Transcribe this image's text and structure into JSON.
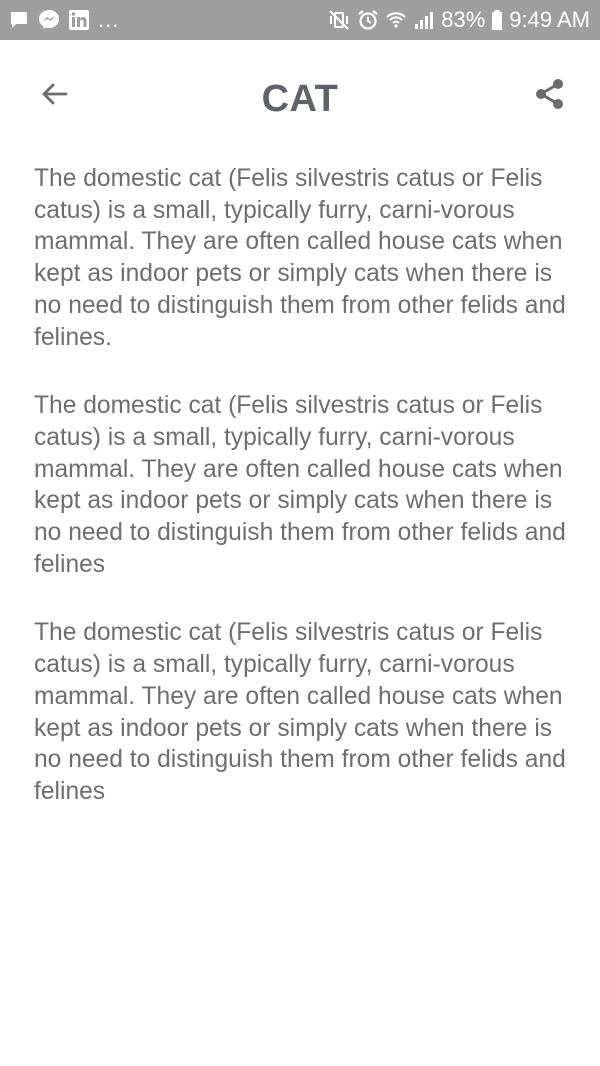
{
  "status_bar": {
    "dots": "...",
    "battery_percent": "83%",
    "time": "9:49 AM",
    "icons": [
      "chat-bubble-icon",
      "messenger-icon",
      "linkedin-icon",
      "mute-vibrate-icon",
      "alarm-icon",
      "wifi-icon",
      "signal-icon",
      "battery-icon"
    ],
    "background": "#9e9e9e"
  },
  "header": {
    "title": "CAT",
    "back_icon": "arrow-back-icon",
    "share_icon": "share-icon"
  },
  "content": {
    "paragraphs": [
      "The domestic cat (Felis silvestris catus or Felis catus) is a small, typically furry, carni-vorous mammal. They are often called house cats when kept as indoor pets or simply cats when there is no need to distinguish them from other felids and felines.",
      "The domestic cat (Felis silvestris catus or Felis catus) is a small, typically furry, carni-vorous mammal. They are often called house cats when kept as indoor pets or simply cats when there is no need to distinguish them from other felids and felines",
      "The domestic cat (Felis silvestris catus or Felis catus) is a small, typically furry, carni-vorous mammal. They are often called house cats when kept as indoor pets or simply cats when there is no need to distinguish them from other felids and felines"
    ],
    "text_color": "#6d6d72"
  }
}
